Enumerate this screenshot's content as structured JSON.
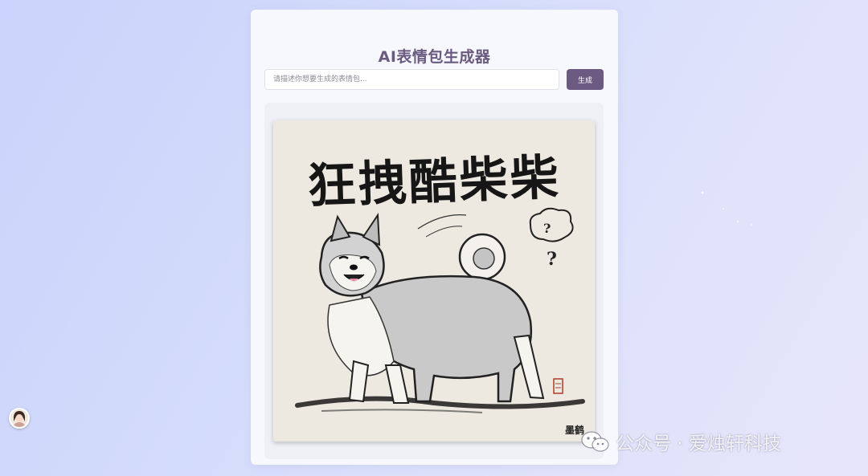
{
  "app": {
    "title": "AI表情包生成器"
  },
  "search": {
    "placeholder": "请描述你想要生成的表情包...",
    "value": ""
  },
  "actions": {
    "generate_label": "生成"
  },
  "result": {
    "meme_caption": "狂拽酷柴柴",
    "thought_bubble_text": "?",
    "question_mark": "?",
    "artist_signature": "墨鹤"
  },
  "watermark": {
    "text": "公众号 · 爱烛轩科技",
    "icon": "wechat-icon"
  },
  "colors": {
    "accent": "#6d5a82",
    "title": "#6a5a80",
    "background_start": "#c9d3fb",
    "background_end": "#e6e4fa"
  }
}
